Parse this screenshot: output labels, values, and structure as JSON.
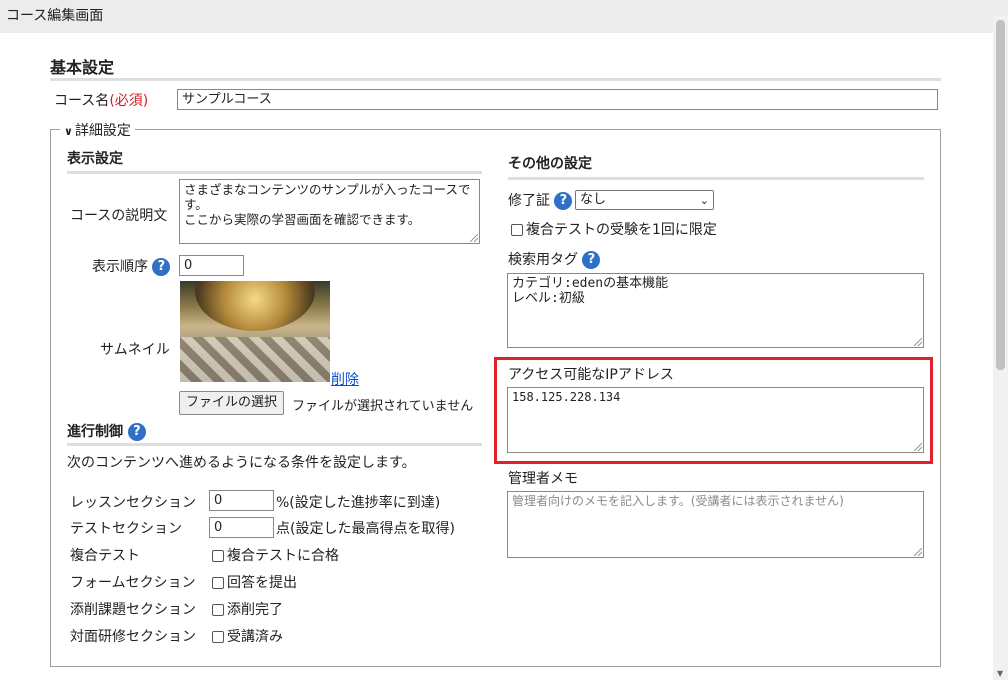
{
  "window": {
    "title": "コース編集画面"
  },
  "basic": {
    "title": "基本設定",
    "course_name_label": "コース名",
    "required_label": "(必須)",
    "course_name_value": "サンプルコース"
  },
  "details": {
    "legend": "詳細設定",
    "display": {
      "title": "表示設定",
      "description_label": "コースの説明文",
      "description_value": "さまざまなコンテンツのサンプルが入ったコースです。\nここから実際の学習画面を確認できます。",
      "order_label": "表示順序",
      "order_value": "0",
      "thumbnail_label": "サムネイル",
      "delete_link": "削除",
      "file_button": "ファイルの選択",
      "file_status": "ファイルが選択されていません"
    },
    "progress": {
      "title": "進行制御",
      "description": "次のコンテンツへ進めるようになる条件を設定します。",
      "rows": [
        {
          "label": "レッスンセクション",
          "value": "0",
          "suffix": "%(設定した進捗率に到達)"
        },
        {
          "label": "テストセクション",
          "value": "0",
          "suffix": "点(設定した最高得点を取得)"
        },
        {
          "label": "複合テスト",
          "check": "複合テストに合格"
        },
        {
          "label": "フォームセクション",
          "check": "回答を提出"
        },
        {
          "label": "添削課題セクション",
          "check": "添削完了"
        },
        {
          "label": "対面研修セクション",
          "check": "受講済み"
        }
      ]
    },
    "other": {
      "title": "その他の設定",
      "certificate_label": "修了証",
      "certificate_value": "なし",
      "limit_checkbox": "複合テストの受験を1回に限定",
      "tags_label": "検索用タグ",
      "tags_value": "カテゴリ:edenの基本機能\nレベル:初級",
      "ip_label": "アクセス可能なIPアドレス",
      "ip_value": "158.125.228.134",
      "memo_label": "管理者メモ",
      "memo_placeholder": "管理者向けのメモを記入します。(受講者には表示されません)"
    }
  },
  "colors": {
    "highlight": "#e0202a",
    "help_icon": "#2f6fc5",
    "link": "#0b4fd1",
    "required": "#d0202a"
  }
}
